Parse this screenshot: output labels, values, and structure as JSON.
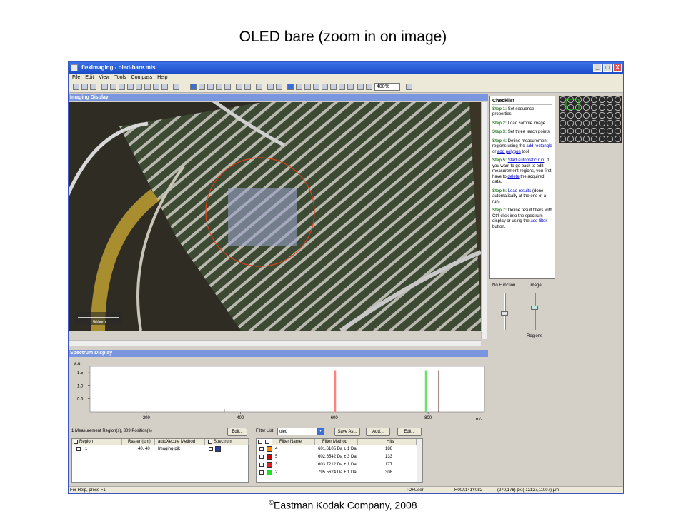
{
  "slide": {
    "title": "OLED bare (zoom in on image)",
    "footer_mark": "©",
    "footer_text": "Eastman Kodak Company, 2008"
  },
  "window": {
    "title": "flexImaging - oled-bare.mis",
    "min_label": "_",
    "max_label": "□",
    "close_label": "X"
  },
  "menu": [
    "File",
    "Edit",
    "View",
    "Tools",
    "Compass",
    "Help"
  ],
  "toolbar": {
    "zoom": "400%"
  },
  "imaging": {
    "header": "Imaging Display",
    "scale_label": "500um"
  },
  "checklist": {
    "title": "Checklist",
    "steps": [
      {
        "label": "Step 1:",
        "text": "Set sequence properties"
      },
      {
        "label": "Step 2:",
        "text": "Load sample image"
      },
      {
        "label": "Step 3:",
        "text": "Set three teach points"
      },
      {
        "label": "Step 4:",
        "pre": "Define measurement regions using the",
        "link1": "add rectangle",
        "mid": "or",
        "link2": "add polygon",
        "post": "tool"
      },
      {
        "label": "Step 5:",
        "link1": "Start automatic run",
        "pre": "If you want to go back to edit measurement regions, you first have to",
        "link2": "delete",
        "post": "the acquired data."
      },
      {
        "label": "Step 6:",
        "link1": "Load results",
        "post": "(done automatically at the end of a run)"
      },
      {
        "label": "Step 7:",
        "pre": "Define result filters with Ctrl-click into the spectrum display or using the",
        "link1": "add filter",
        "post": "button."
      }
    ]
  },
  "sliders": {
    "left_label": "No Function",
    "right_label": "Image",
    "bottom_label": "Regions",
    "left_level": 0.45,
    "right_level": 0.6
  },
  "spectrum": {
    "header": "Spectrum Display",
    "ylabel": "a.u.",
    "xlabel": "m/z",
    "yticks": [
      "1.5",
      "1.0",
      "0.5"
    ],
    "xticks": [
      "200",
      "400",
      "600",
      "800"
    ]
  },
  "chart_data": {
    "type": "bar",
    "xlabel": "m/z",
    "ylabel": "a.u.",
    "xlim": [
      80,
      920
    ],
    "ylim": [
      0,
      1.75
    ],
    "peaks": [
      {
        "x": 601.6,
        "y": 1.6,
        "color": "#ff8080"
      },
      {
        "x": 795.6,
        "y": 1.6,
        "color": "#6be06b"
      },
      {
        "x": 823.0,
        "y": 1.6,
        "color": "#5a1010"
      }
    ]
  },
  "regions": {
    "summary": "1 Measurement Region(s), 309 Position(s)",
    "edit_label": "Edit...",
    "headers": [
      "Region",
      "Raster (µm)",
      "autoXecute Method",
      "Spectrum"
    ],
    "rows": [
      {
        "region": "1",
        "raster": "40, 40",
        "method": "Imaging-pjk",
        "swatch": "#2a3fa8"
      }
    ]
  },
  "filters": {
    "list_label": "Filter List:",
    "list_value": "oled",
    "save_label": "Save As...",
    "add_label": "Add...",
    "edit_label": "Edit...",
    "headers": [
      "Filter Name",
      "Filter Method",
      "Hits"
    ],
    "rows": [
      {
        "name": "4",
        "method": "601.6105 Da ± 1 Da",
        "hits": "188",
        "color": "#ff8800"
      },
      {
        "name": "5",
        "method": "602.6542 Da ± 3 Da",
        "hits": "133",
        "color": "#d00000"
      },
      {
        "name": "3",
        "method": "603.7212 Da ± 1 Da",
        "hits": "177",
        "color": "#e02020"
      },
      {
        "name": "2",
        "method": "795.5624 Da ± 1 Da",
        "hits": "308",
        "color": "#22dd22"
      }
    ]
  },
  "status": {
    "help": "For Help, press F1",
    "user": "TOFUser",
    "position": "R00X141Y082",
    "coords": "(270,176) px (-12127,11007) µm"
  }
}
